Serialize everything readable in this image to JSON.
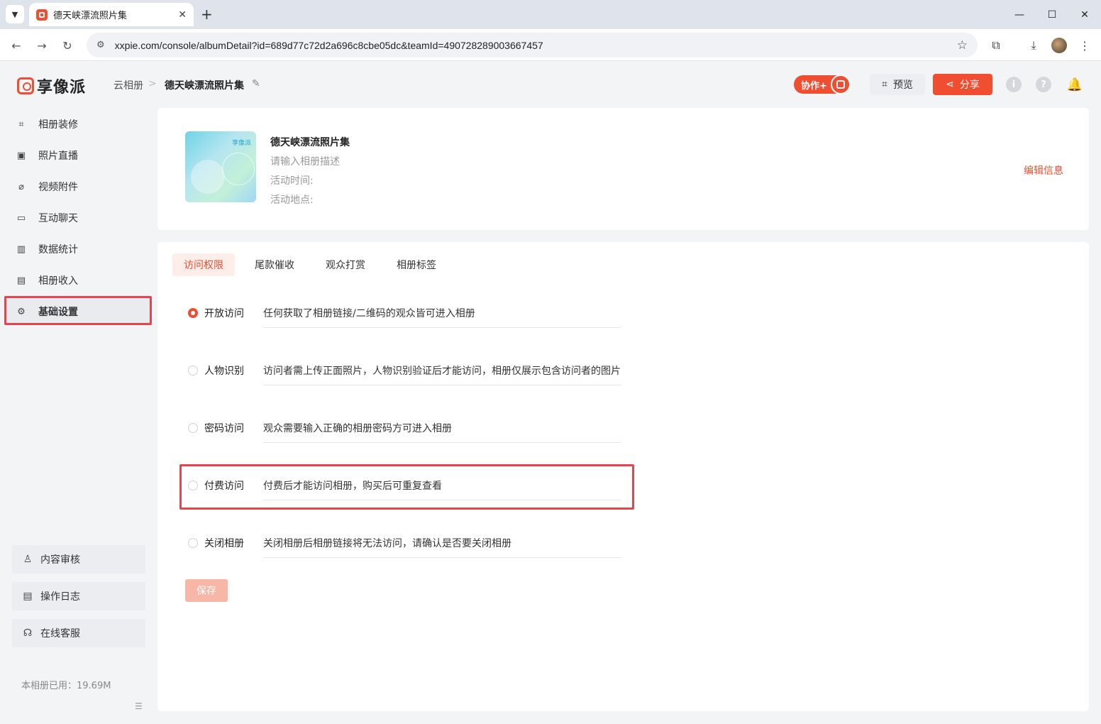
{
  "browser": {
    "tab_title": "德天峡漂流照片集",
    "url": "xxpie.com/console/albumDetail?id=689d77c72d2a696c8cbe05dc&teamId=490728289003667457"
  },
  "header": {
    "logo": "享像派",
    "breadcrumb_root": "云相册",
    "breadcrumb_sep": ">",
    "breadcrumb_current": "德天峡漂流照片集",
    "collab_label": "协作+",
    "preview_label": "预览",
    "share_label": "分享"
  },
  "sidebar": {
    "items": [
      {
        "label": "相册装修",
        "icon": "decorate-icon"
      },
      {
        "label": "照片直播",
        "icon": "image-icon"
      },
      {
        "label": "视频附件",
        "icon": "paperclip-icon"
      },
      {
        "label": "互动聊天",
        "icon": "chat-icon"
      },
      {
        "label": "数据统计",
        "icon": "chart-icon"
      },
      {
        "label": "相册收入",
        "icon": "income-icon"
      },
      {
        "label": "基础设置",
        "icon": "gear-icon"
      }
    ],
    "bottom": [
      {
        "label": "内容审核",
        "icon": "user-icon"
      },
      {
        "label": "操作日志",
        "icon": "log-icon"
      },
      {
        "label": "在线客服",
        "icon": "headset-icon"
      }
    ],
    "storage_label": "本相册已用：19.69M"
  },
  "album": {
    "cover_logo": "享像派",
    "title": "德天峡漂流照片集",
    "description_placeholder": "请输入相册描述",
    "time_label": "活动时间:",
    "location_label": "活动地点:",
    "edit_info": "编辑信息"
  },
  "tabs": [
    "访问权限",
    "尾款催收",
    "观众打赏",
    "相册标签"
  ],
  "access_options": [
    {
      "label": "开放访问",
      "desc": "任何获取了相册链接/二维码的观众皆可进入相册",
      "checked": true
    },
    {
      "label": "人物识别",
      "desc": "访问者需上传正面照片，人物识别验证后才能访问，相册仅展示包含访问者的图片",
      "checked": false
    },
    {
      "label": "密码访问",
      "desc": "观众需要输入正确的相册密码方可进入相册",
      "checked": false
    },
    {
      "label": "付费访问",
      "desc": "付费后才能访问相册，购买后可重复查看",
      "checked": false
    },
    {
      "label": "关闭相册",
      "desc": "关闭相册后相册链接将无法访问，请确认是否要关闭相册",
      "checked": false
    }
  ],
  "save_label": "保存"
}
